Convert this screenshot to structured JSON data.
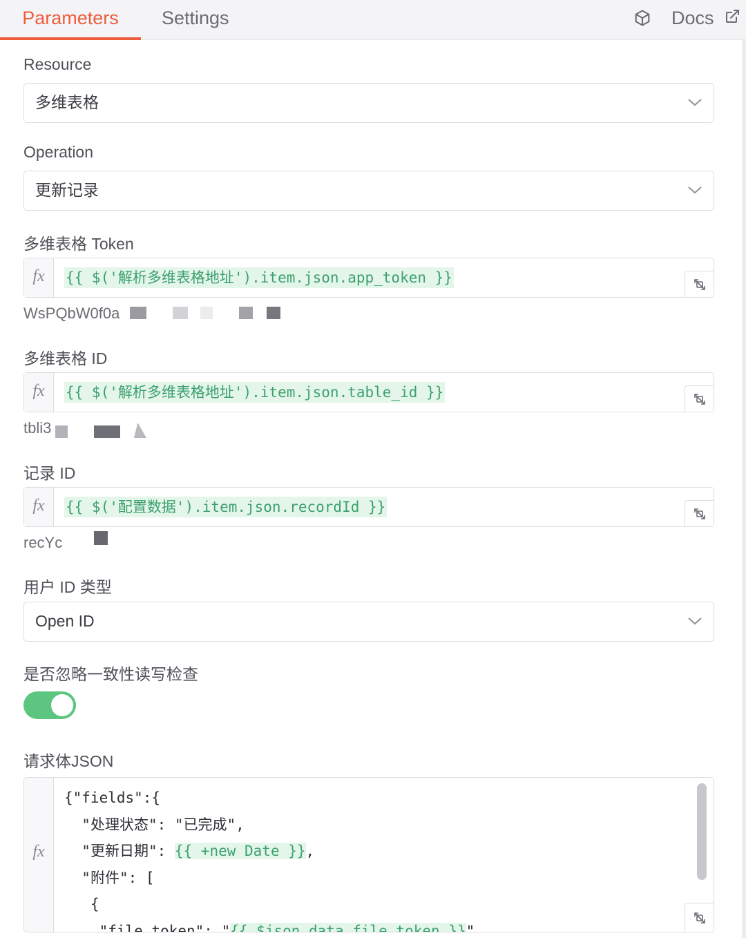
{
  "tabs": {
    "parameters": "Parameters",
    "settings": "Settings",
    "docs": "Docs"
  },
  "icons": {
    "cube": "cube-icon",
    "external": "external-link-icon",
    "chevron": "chevron-down-icon",
    "expand": "expand-icon"
  },
  "fields": {
    "resource": {
      "label": "Resource",
      "value": "多维表格"
    },
    "operation": {
      "label": "Operation",
      "value": "更新记录"
    },
    "token": {
      "label": "多维表格 Token",
      "fx": "fx",
      "expression": "{{ $('解析多维表格地址').item.json.app_token }}",
      "preview": "WsPQbW0f0a"
    },
    "table_id": {
      "label": "多维表格 ID",
      "fx": "fx",
      "expression": "{{ $('解析多维表格地址').item.json.table_id }}",
      "preview": "tbli3"
    },
    "record_id": {
      "label": "记录 ID",
      "fx": "fx",
      "expression": "{{ $('配置数据').item.json.recordId }}",
      "preview": "recYc"
    },
    "user_id_type": {
      "label": "用户 ID 类型",
      "value": "Open ID"
    },
    "ignore_consistency": {
      "label": "是否忽略一致性读写检查",
      "enabled": true
    },
    "body_json": {
      "label": "请求体JSON",
      "fx": "fx",
      "lines": [
        {
          "indent": "",
          "text": "{\"fields\":{",
          "expr": "",
          "tail": ""
        },
        {
          "indent": "  ",
          "text": "\"处理状态\": \"已完成\",",
          "expr": "",
          "tail": ""
        },
        {
          "indent": "  ",
          "text": "\"更新日期\": ",
          "expr": "{{ +new Date }}",
          "tail": ","
        },
        {
          "indent": "  ",
          "text": "\"附件\": [",
          "expr": "",
          "tail": ""
        },
        {
          "indent": "   ",
          "text": "{",
          "expr": "",
          "tail": ""
        },
        {
          "indent": "    ",
          "text": "\"file_token\": \"",
          "expr": "{{ $json.data.file_token }}",
          "tail": "\""
        }
      ]
    }
  },
  "colors": {
    "accent": "#ee5c3c",
    "expression_text": "#3ca06e",
    "expression_bg": "#e4f6ea",
    "toggle_on": "#5cc680"
  }
}
